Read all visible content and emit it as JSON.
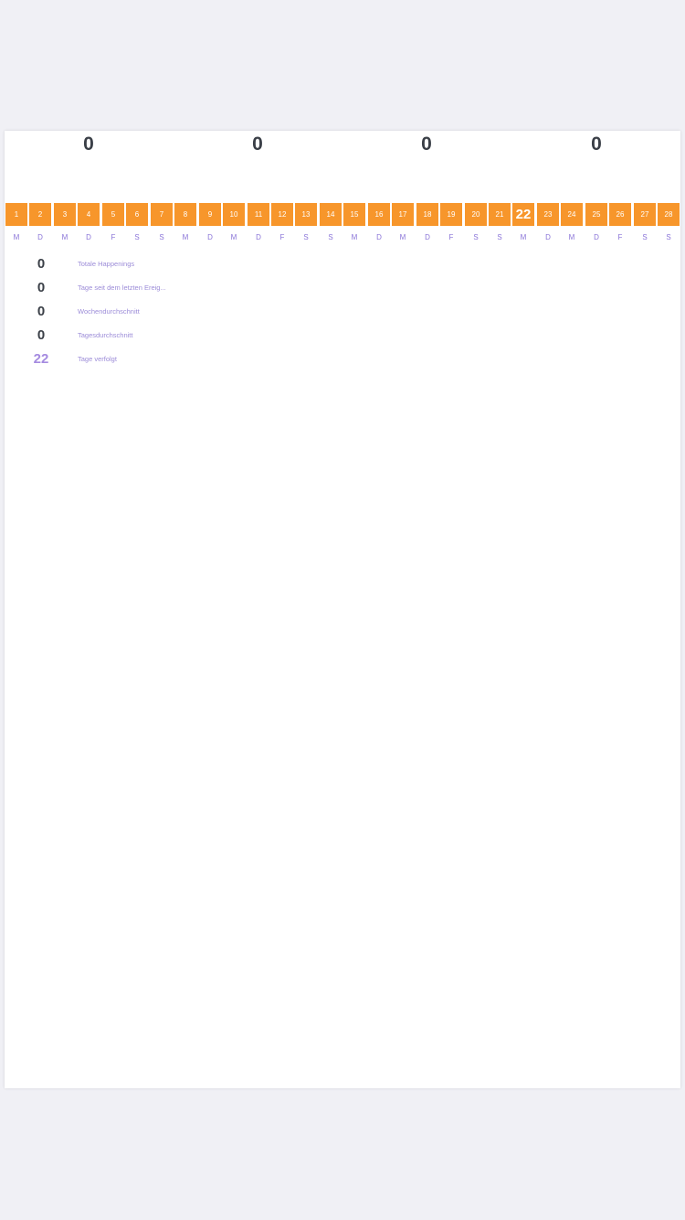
{
  "top_counts": [
    "0",
    "0",
    "0",
    "0"
  ],
  "days": [
    "1",
    "2",
    "3",
    "4",
    "5",
    "6",
    "7",
    "8",
    "9",
    "10",
    "11",
    "12",
    "13",
    "14",
    "15",
    "16",
    "17",
    "18",
    "19",
    "20",
    "21",
    "22",
    "23",
    "24",
    "25",
    "26",
    "27",
    "28"
  ],
  "today_index": 21,
  "weekdays": [
    "M",
    "D",
    "M",
    "D",
    "F",
    "S",
    "S",
    "M",
    "D",
    "M",
    "D",
    "F",
    "S",
    "S",
    "M",
    "D",
    "M",
    "D",
    "F",
    "S",
    "S",
    "M",
    "D",
    "M",
    "D",
    "F",
    "S",
    "S"
  ],
  "stats": [
    {
      "value": "0",
      "label": "Totale Happenings"
    },
    {
      "value": "0",
      "label": "Tage seit dem letzten Ereig..."
    },
    {
      "value": "0",
      "label": "Wochendurchschnitt"
    },
    {
      "value": "0",
      "label": "Tagesdurchschnitt"
    },
    {
      "value": "22",
      "label": "Tage verfolgt"
    }
  ],
  "colors": {
    "background": "#f0f0f5",
    "card": "#ffffff",
    "day_cell": "#f7962b",
    "weekday_text": "#8a74d8",
    "stat_text": "#3a3f47",
    "accent": "#a58be0"
  }
}
